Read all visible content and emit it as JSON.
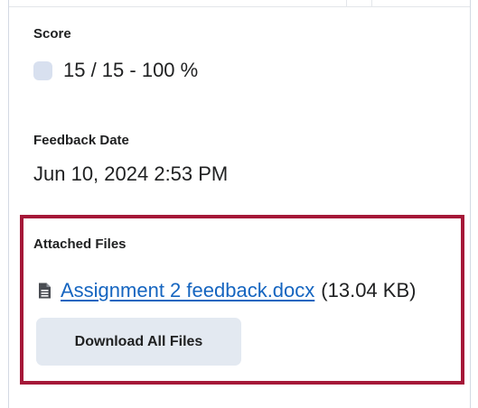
{
  "score": {
    "label": "Score",
    "value": "15 / 15 - 100 %"
  },
  "feedback_date": {
    "label": "Feedback Date",
    "value": "Jun 10, 2024 2:53 PM"
  },
  "attached_files": {
    "label": "Attached Files",
    "files": [
      {
        "name": "Assignment 2 feedback.docx",
        "size": "(13.04 KB)",
        "icon": "document-icon"
      }
    ],
    "download_all_label": "Download All Files"
  },
  "colors": {
    "highlight_border": "#a51838",
    "link": "#1565c0",
    "button_bg": "#e3e9f1",
    "score_swatch": "#d8e0ef",
    "text": "#202122"
  }
}
